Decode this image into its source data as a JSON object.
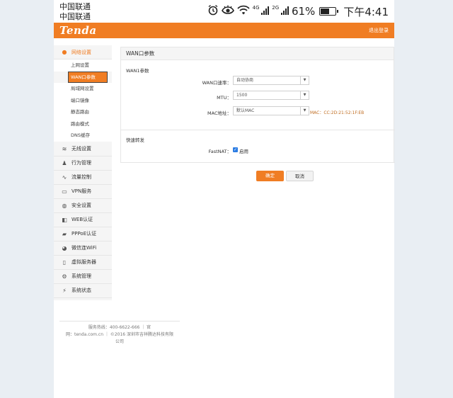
{
  "status_bar": {
    "carrier_1": "中国联通",
    "carrier_2": "中国联通",
    "net_4g": "4G",
    "net_2g": "2G",
    "battery": "61%",
    "battery_level": 0.61,
    "time": "下午4:41",
    "icons": [
      "alarm-icon",
      "eye-icon",
      "wifi-icon",
      "signal-4g-icon",
      "signal-2g-icon",
      "battery-icon"
    ]
  },
  "header": {
    "logo": "Tenda",
    "logout": "退出登录",
    "brand_color": "#f07d23"
  },
  "sidebar": {
    "network_settings": "网络设置",
    "sub_items": [
      "上网设置",
      "WAN口参数",
      "局域网设置",
      "端口镜像",
      "静态路由",
      "路由模式",
      "DNS缓存"
    ],
    "items": [
      "无线设置",
      "行为管理",
      "流量控制",
      "VPN服务",
      "安全设置",
      "WEB认证",
      "PPPoE认证",
      "微信连WiFi",
      "虚拟服务器",
      "系统管理",
      "系统状态"
    ]
  },
  "main": {
    "panel_title": "WAN口参数",
    "section_wan1": "WAN1参数",
    "wan_speed_label": "WAN口速率：",
    "wan_speed_value": "自动协商",
    "mtu_label": "MTU：",
    "mtu_value": "1500",
    "mac_label": "MAC地址：",
    "mac_value": "默认MAC",
    "mac_note": "MAC：CC:2D:21:52:1F:EB",
    "section_fast": "快速转发",
    "fastnat_label": "FastNAT：",
    "fastnat_checkbox": "启用",
    "fastnat_enabled": true,
    "ok_button": "确定",
    "cancel_button": "取消"
  },
  "footer": {
    "line1": "服务热线：400-6622-666 ｜ 官",
    "line2": "网：tenda.com.cn ｜ ©2016 深圳市吉祥腾达科技有限",
    "line3": "公司"
  }
}
